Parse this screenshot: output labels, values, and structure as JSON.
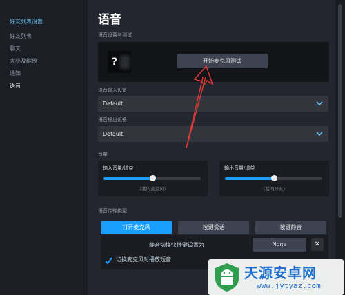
{
  "sidebar": {
    "header": "好友列表设置",
    "items": [
      {
        "label": "好友列表",
        "active": false
      },
      {
        "label": "聊天",
        "active": false
      },
      {
        "label": "大小及缩放",
        "active": false
      },
      {
        "label": "通知",
        "active": false
      },
      {
        "label": "语音",
        "active": true
      }
    ]
  },
  "main": {
    "title": "语音",
    "test_section": {
      "label": "语音设置与测试",
      "avatar_glyph": "?",
      "test_button": "开始麦克风测试"
    },
    "input_device": {
      "label": "语音输入设备",
      "value": "Default"
    },
    "output_device": {
      "label": "语音输出设备",
      "value": "Default"
    },
    "volume": {
      "label": "音量",
      "input": {
        "label": "输入音量/增益",
        "caption": "（我的麦克风）",
        "level": 0.5
      },
      "output": {
        "label": "输出音量/增益",
        "caption": "（我的好友）",
        "level": 0.5
      }
    },
    "transmission": {
      "label": "语音传输类型",
      "buttons": [
        {
          "label": "打开麦克风",
          "selected": true
        },
        {
          "label": "按键说话",
          "selected": false
        },
        {
          "label": "按键静音",
          "selected": false
        }
      ],
      "hotkey_label": "静音切换快捷键设置为",
      "hotkey_value": "None",
      "clear_glyph": "✕",
      "checkbox_label": "切换麦克风时播放短音",
      "checkbox_checked": true
    }
  },
  "watermark": {
    "name": "天源安卓网",
    "url": "www.jytyaz.com"
  },
  "colors": {
    "accent": "#1a9fff",
    "arrow": "#e53935"
  }
}
